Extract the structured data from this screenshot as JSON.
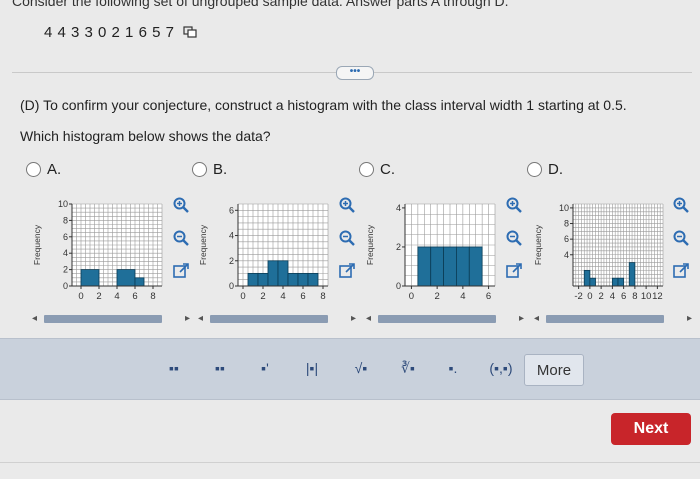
{
  "header": {
    "text": "Consider the following set of ungrouped sample data. Answer parts A through D."
  },
  "dataset": {
    "text": "4  4  3  3  0  2  1  6  5  7"
  },
  "expander_label": "•••",
  "question": {
    "text": "(D) To confirm your conjecture, construct a histogram with the class interval width 1 starting at 0.5.",
    "ask": "Which histogram below shows the data?"
  },
  "options": [
    {
      "label": "A."
    },
    {
      "label": "B."
    },
    {
      "label": "C."
    },
    {
      "label": "D."
    }
  ],
  "ylabel": "Frequency",
  "chart_data": [
    {
      "type": "bar",
      "option": "A",
      "ylabel": "Frequency",
      "xticks": [
        "0",
        "2",
        "4",
        "6",
        "8"
      ],
      "yticks": [
        "0",
        "2",
        "4",
        "6",
        "8",
        "10"
      ],
      "xlim": [
        -1,
        9
      ],
      "ylim": [
        0,
        10
      ],
      "bars": [
        {
          "x0": 0,
          "x1": 2,
          "y": 2
        },
        {
          "x0": 4,
          "x1": 6,
          "y": 2
        },
        {
          "x0": 6,
          "x1": 7,
          "y": 1
        }
      ]
    },
    {
      "type": "bar",
      "option": "B",
      "ylabel": "Frequency",
      "xticks": [
        "0",
        "2",
        "4",
        "6",
        "8"
      ],
      "yticks": [
        "0",
        "2",
        "4",
        "6"
      ],
      "xlim": [
        -0.5,
        8.5
      ],
      "ylim": [
        0,
        6.5
      ],
      "bars": [
        {
          "x0": 0.5,
          "x1": 1.5,
          "y": 1
        },
        {
          "x0": 1.5,
          "x1": 2.5,
          "y": 1
        },
        {
          "x0": 2.5,
          "x1": 3.5,
          "y": 2
        },
        {
          "x0": 3.5,
          "x1": 4.5,
          "y": 2
        },
        {
          "x0": 4.5,
          "x1": 5.5,
          "y": 1
        },
        {
          "x0": 5.5,
          "x1": 6.5,
          "y": 1
        },
        {
          "x0": 6.5,
          "x1": 7.5,
          "y": 1
        }
      ]
    },
    {
      "type": "bar",
      "option": "C",
      "ylabel": "Frequency",
      "xticks": [
        "0",
        "2",
        "4",
        "6"
      ],
      "yticks": [
        "0",
        "2",
        "4"
      ],
      "xlim": [
        -0.5,
        6.5
      ],
      "ylim": [
        0,
        4.2
      ],
      "bars": [
        {
          "x0": 0.5,
          "x1": 1.5,
          "y": 2
        },
        {
          "x0": 1.5,
          "x1": 2.5,
          "y": 2
        },
        {
          "x0": 2.5,
          "x1": 3.5,
          "y": 2
        },
        {
          "x0": 3.5,
          "x1": 4.5,
          "y": 2
        },
        {
          "x0": 4.5,
          "x1": 5.5,
          "y": 2
        }
      ]
    },
    {
      "type": "bar",
      "option": "D",
      "ylabel": "Frequency",
      "xticks": [
        "-2",
        "0",
        "2",
        "4",
        "6",
        "8",
        "10",
        "12"
      ],
      "yticks": [
        "4",
        "6",
        "8",
        "10"
      ],
      "xlim": [
        -3,
        13
      ],
      "ylim": [
        0,
        10.5
      ],
      "bars": [
        {
          "x0": -1,
          "x1": 0,
          "y": 2
        },
        {
          "x0": 0,
          "x1": 1,
          "y": 1
        },
        {
          "x0": 4,
          "x1": 5,
          "y": 1
        },
        {
          "x0": 5,
          "x1": 6,
          "y": 1
        },
        {
          "x0": 7,
          "x1": 8,
          "y": 3
        }
      ]
    }
  ],
  "toolbar": {
    "buttons": [
      "▪▪",
      "▪▪",
      "▪'",
      "|▪|",
      "√▪",
      "∛▪",
      "▪.",
      "(▪,▪)"
    ],
    "more_label": "More"
  },
  "next_label": "Next",
  "colors": {
    "bar_fill": "#1f6f99",
    "bar_stroke": "#0b3c55",
    "accent": "#2d6cb2",
    "next_bg": "#c8252a"
  }
}
